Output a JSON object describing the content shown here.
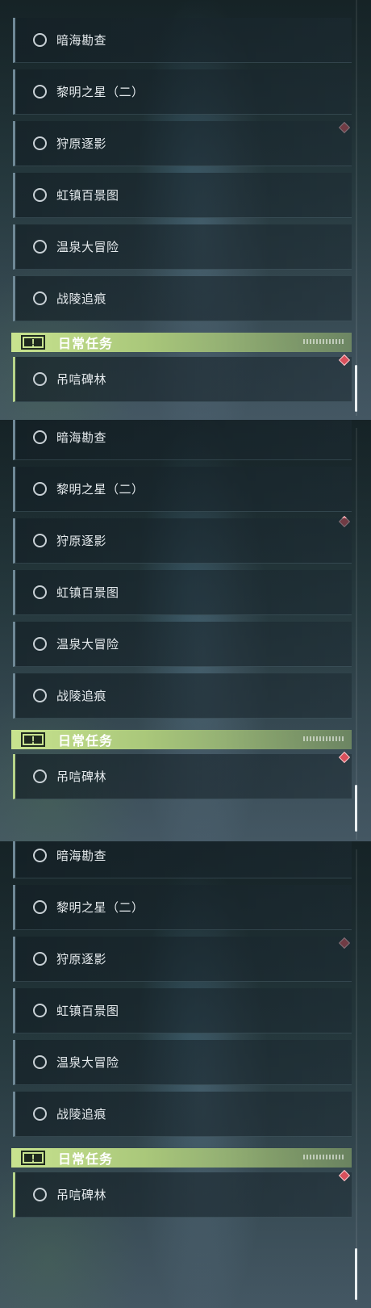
{
  "quests": [
    {
      "label": "暗海勘查",
      "pinned": false
    },
    {
      "label": "黎明之星（二）",
      "pinned": true
    },
    {
      "label": "狩原逐影",
      "pinned": false
    },
    {
      "label": "虹镇百景图",
      "pinned": false
    },
    {
      "label": "温泉大冒险",
      "pinned": false
    },
    {
      "label": "战陵追痕",
      "pinned": false
    }
  ],
  "daily": {
    "badge": "!",
    "title": "日常任务",
    "quests": [
      {
        "label": "吊唁碑林",
        "pinned": true
      }
    ]
  },
  "colors": {
    "accent_green": "#c8e38f",
    "pin_red": "#d8505c"
  },
  "icons": {
    "quest_status": "circle-outline-icon",
    "tracked_marker": "diamond-marker-icon",
    "daily_badge": "exclamation-badge-icon"
  }
}
